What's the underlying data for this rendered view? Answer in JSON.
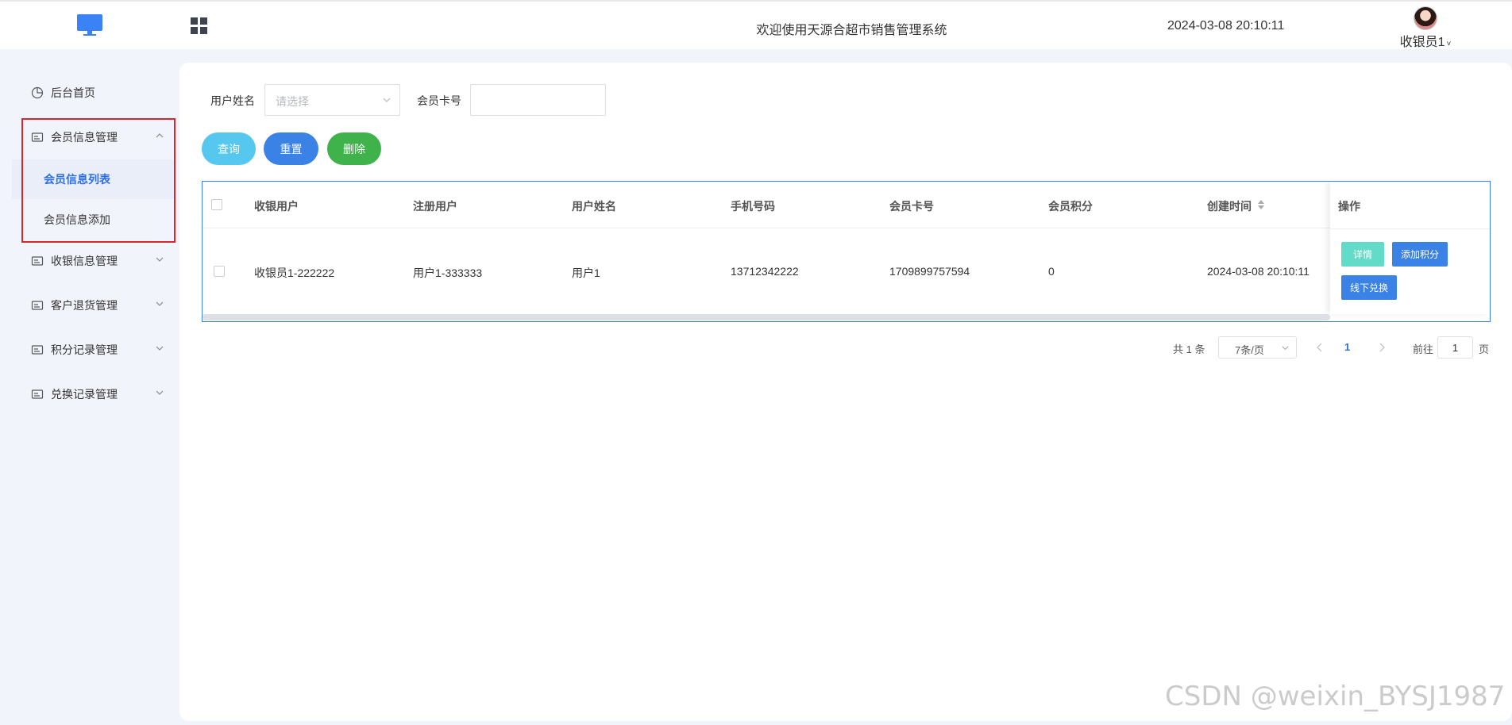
{
  "header": {
    "title": "欢迎使用天源合超市销售管理系统",
    "datetime": "2024-03-08 20:10:11",
    "user_name": "收银员1",
    "user_caret": "˅"
  },
  "sidebar": {
    "items": [
      {
        "label": "后台首页",
        "icon": "pie-chart-icon"
      },
      {
        "label": "会员信息管理",
        "icon": "card-icon",
        "expanded": true
      },
      {
        "label": "收银信息管理",
        "icon": "card-icon"
      },
      {
        "label": "客户退货管理",
        "icon": "card-icon"
      },
      {
        "label": "积分记录管理",
        "icon": "card-icon"
      },
      {
        "label": "兑换记录管理",
        "icon": "card-icon"
      }
    ],
    "sub_items": [
      {
        "label": "会员信息列表",
        "active": true
      },
      {
        "label": "会员信息添加",
        "active": false
      }
    ]
  },
  "filters": {
    "username_label": "用户姓名",
    "username_placeholder": "请选择",
    "card_label": "会员卡号",
    "card_value": ""
  },
  "buttons": {
    "query": "查询",
    "reset": "重置",
    "delete": "删除"
  },
  "table": {
    "columns": [
      "收银用户",
      "注册用户",
      "用户姓名",
      "手机号码",
      "会员卡号",
      "会员积分",
      "创建时间",
      "操作"
    ],
    "rows": [
      {
        "cashier": "收银员1-222222",
        "register_user": "用户1-333333",
        "name": "用户1",
        "phone": "13712342222",
        "card": "1709899757594",
        "points": "0",
        "created": "2024-03-08 20:10:11"
      }
    ],
    "actions": {
      "detail": "详情",
      "add_points": "添加积分",
      "offline_redeem": "线下兑换"
    }
  },
  "pagination": {
    "total": "共 1 条",
    "page_size": "7条/页",
    "current_page": "1",
    "goto_prefix": "前往",
    "goto_value": "1",
    "goto_suffix": "页"
  },
  "watermark": "CSDN @weixin_BYSJ1987",
  "colors": {
    "primary": "#3b82e6",
    "query": "#56c7ee",
    "delete": "#40b24b",
    "detail": "#62dcc9",
    "highlight_box": "#d9252b"
  }
}
